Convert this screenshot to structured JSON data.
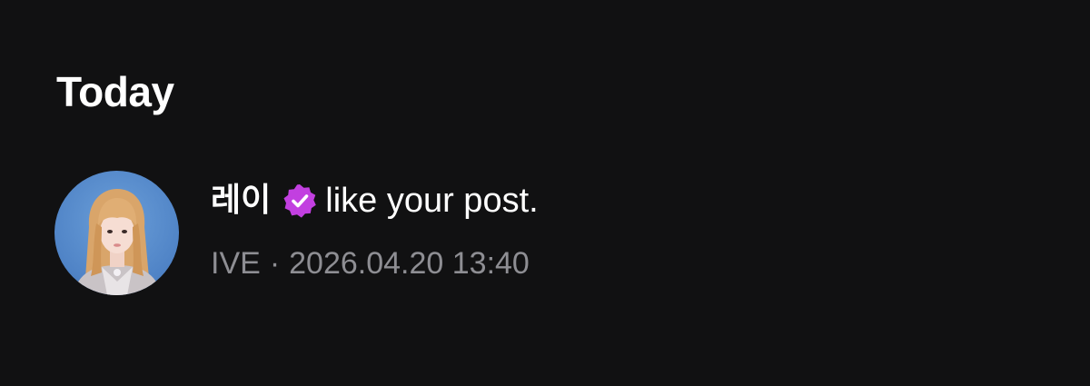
{
  "section": {
    "title": "Today"
  },
  "notification": {
    "avatar_icon": "user-avatar",
    "username": "레이",
    "verified_icon": "verified-badge-icon",
    "verified_color": "#c23fe0",
    "action_text": "like your post.",
    "group": "IVE",
    "separator": "·",
    "timestamp": "2026.04.20 13:40"
  },
  "colors": {
    "background": "#111112",
    "primary_text": "#ffffff",
    "secondary_text": "#8e8e93"
  }
}
